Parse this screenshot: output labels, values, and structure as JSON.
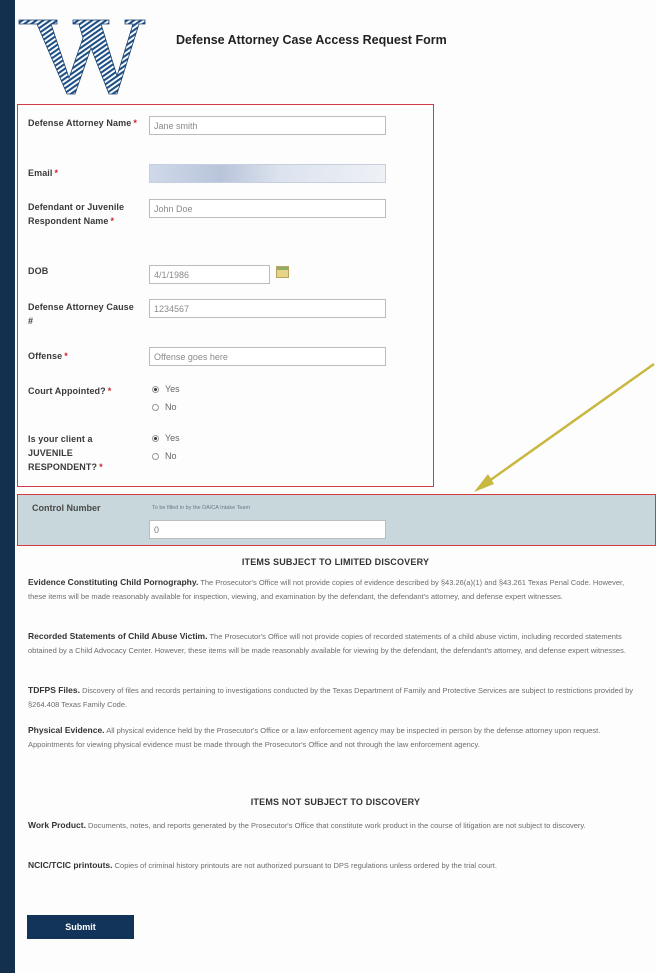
{
  "form_title": "Defense Attorney Case Access Request Form",
  "fields": {
    "attorney_name": {
      "label": "Defense Attorney Name",
      "value": "Jane smith"
    },
    "email": {
      "label": "Email",
      "value": ""
    },
    "defendant": {
      "label": "Defendant or Juvenile Respondent Name",
      "value": "John Doe"
    },
    "dob": {
      "label": "DOB",
      "value": "4/1/1986"
    },
    "cause": {
      "label": "Defense Attorney Cause #",
      "value": "1234567"
    },
    "offense": {
      "label": "Offense",
      "value": "Offense goes here"
    },
    "court_appointed": {
      "label": "Court Appointed?",
      "options": [
        "Yes",
        "No"
      ],
      "selected": "Yes"
    },
    "juvenile": {
      "label": "Is your client a JUVENILE RESPONDENT?",
      "options": [
        "Yes",
        "No"
      ],
      "selected": "Yes"
    }
  },
  "required_marker": "*",
  "control": {
    "label": "Control Number",
    "hint": "To be filled in by the DA/CA Intake Team",
    "value": "0"
  },
  "limited": {
    "heading": "ITEMS SUBJECT TO LIMITED DISCOVERY",
    "items": [
      {
        "title": "Evidence Constituting Child Pornography.",
        "text": "The Prosecutor's Office will not provide copies of evidence described by §43.26(a)(1) and §43.261 Texas Penal Code. However, these items will be made reasonably available for inspection, viewing, and examination by the defendant, the defendant's attorney, and defense expert witnesses."
      },
      {
        "title": "Recorded Statements of Child Abuse Victim.",
        "text": "The Prosecutor's Office will not provide copies of recorded statements of a child abuse victim, including recorded statements obtained by a Child Advocacy Center. However, these items will be made reasonably available for viewing by the defendant, the defendant's attorney, and defense expert witnesses."
      },
      {
        "title": "TDFPS Files.",
        "text": "Discovery of files and records pertaining to investigations conducted by the Texas Department of Family and Protective Services are subject to restrictions provided by §264.408 Texas Family Code."
      },
      {
        "title": "Physical Evidence.",
        "text": "All physical evidence held by the Prosecutor's Office or a law enforcement agency may be inspected in person by the defense attorney upon request. Appointments for viewing physical evidence must be made through the Prosecutor's Office and not through the law enforcement agency."
      }
    ]
  },
  "not_subject": {
    "heading": "ITEMS NOT SUBJECT TO DISCOVERY",
    "items": [
      {
        "title": "Work Product.",
        "text": "Documents, notes, and reports generated by the Prosecutor's Office that constitute work product in the course of litigation are not subject to discovery."
      },
      {
        "title": "NCIC/TCIC printouts.",
        "text": "Copies of criminal history printouts are not authorized pursuant to DPS regulations unless ordered by the trial court."
      }
    ]
  },
  "submit_label": "Submit",
  "colors": {
    "navy": "#14304f",
    "red_outline": "#d23a44",
    "control_bg": "#c7d7dc",
    "arrow": "#c9b840"
  }
}
